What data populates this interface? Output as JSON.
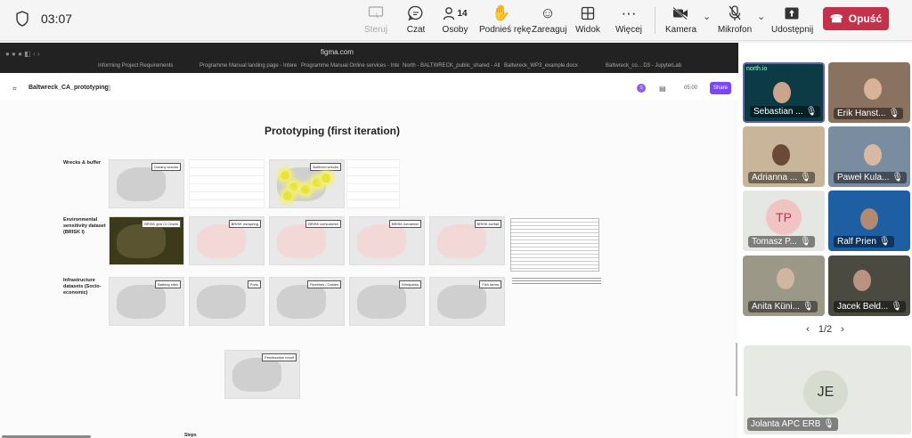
{
  "meeting": {
    "timer": "03:07",
    "toolbar": [
      {
        "label": "Steruj",
        "icon": "control-icon",
        "disabled": true
      },
      {
        "label": "Czat",
        "icon": "chat-icon",
        "disabled": false
      },
      {
        "label": "Osoby",
        "icon": "people-icon",
        "disabled": false,
        "count": "14"
      },
      {
        "label": "Podnieś rękę",
        "icon": "raise-hand-icon",
        "disabled": false
      },
      {
        "label": "Zareaguj",
        "icon": "react-icon",
        "disabled": false
      },
      {
        "label": "Widok",
        "icon": "view-icon",
        "disabled": false
      },
      {
        "label": "Więcej",
        "icon": "more-icon",
        "disabled": false
      },
      {
        "label": "Kamera",
        "icon": "camera-off-icon",
        "disabled": false
      },
      {
        "label": "Mikrofon",
        "icon": "mic-off-icon",
        "disabled": false
      },
      {
        "label": "Udostępnij",
        "icon": "share-tray-icon",
        "disabled": false
      }
    ],
    "leave_label": "Opuść",
    "leave_color": "#c4314b"
  },
  "browser": {
    "url": "figma.com",
    "tabs": [
      "Informing Project Requirements",
      "Programme Manual landing page - Intere...",
      "Programme Manual Online services - Inter...",
      "North - BALTWRECK_public_shared - All...",
      "Baltwreck_WP3_example.docx",
      "Baltwreck_co... D3 - JupyterLab"
    ]
  },
  "figma": {
    "file_name": "Baltwreck_CA_prototyping",
    "avatar_initial": "S",
    "time": "05:00",
    "share_label": "Share",
    "accent": "#7b46ff",
    "page_title": "Prototyping (first iteration)",
    "rows": [
      {
        "label": "Wrecks & buffer",
        "cards": [
          "Oceany wrecks",
          "",
          "Buffered wrecks",
          ""
        ]
      },
      {
        "label": "Environmental sensitivity dataset (BRISK I)",
        "cards": [
          "BRISK grid CI Charts",
          "BRISK ice/spring",
          "BRISK ice/summer",
          "BRISK ice/winter",
          "BRISK ice/fall"
        ]
      },
      {
        "label": "Infrastructure datasets (Socio-economic)",
        "cards": [
          "Bathing sites",
          "Ports",
          "Pipelines / Cables",
          "Windparks",
          "Fish farms"
        ]
      }
    ],
    "result_label": "Prioritization result",
    "steps_label": "Steps"
  },
  "participants": [
    {
      "name": "Sebastian ...",
      "active": true,
      "bg": "#0c3b45"
    },
    {
      "name": "Erik Hanst...",
      "active": false,
      "bg": "#8a7260"
    },
    {
      "name": "Adrianna ...",
      "active": false,
      "bg": "#c9b69a"
    },
    {
      "name": "Paweł Kula...",
      "active": false,
      "bg": "#7a8da0"
    },
    {
      "name": "Tomasz P...",
      "active": false,
      "bg": "#e5e7e3",
      "initials": "TP"
    },
    {
      "name": "Ralf Prien",
      "active": false,
      "bg": "#1e5fa3"
    },
    {
      "name": "Anita Küni...",
      "active": false,
      "bg": "#9c9888"
    },
    {
      "name": "Jacek Bełd...",
      "active": false,
      "bg": "#4a4a40"
    }
  ],
  "pager": "1/2",
  "big_tile": {
    "initials": "JE",
    "name": "Jolanta APC ERB"
  }
}
